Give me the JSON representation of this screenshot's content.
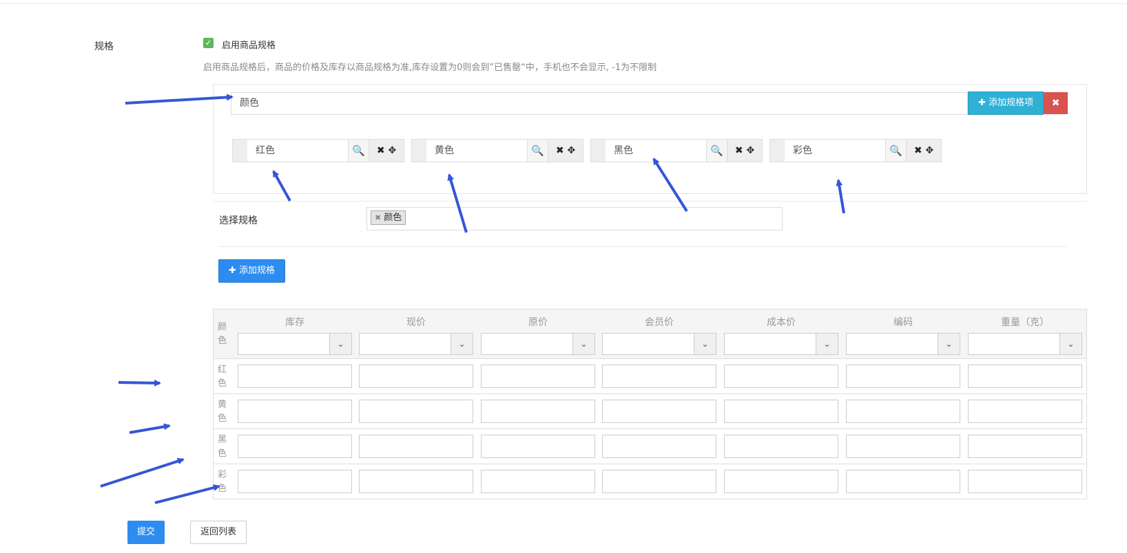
{
  "spec": {
    "label": "规格",
    "enable_checkbox_label": "启用商品规格",
    "enable_checked": true,
    "hint": "启用商品规格后，商品的价格及库存以商品规格为准,库存设置为0则会到”已售罄“中，手机也不会显示, -1为不限制"
  },
  "spec_group": {
    "name_value": "颜色",
    "add_item_label": "✚ 添加规格项",
    "remove_icon": "close-icon",
    "items": [
      {
        "value": "红色"
      },
      {
        "value": "黄色"
      },
      {
        "value": "黑色"
      },
      {
        "value": "彩色"
      }
    ]
  },
  "select_spec": {
    "label": "选择规格",
    "selected_tags": [
      "颜色"
    ]
  },
  "add_spec_label": "✚ 添加规格",
  "table": {
    "first_col_header": "颜色",
    "columns": [
      "库存",
      "现价",
      "原价",
      "会员价",
      "成本价",
      "编码",
      "重量（克）"
    ],
    "rows": [
      "红色",
      "黄色",
      "黑色",
      "彩色"
    ]
  },
  "buttons": {
    "submit": "提交",
    "back": "返回列表"
  },
  "colors": {
    "primary": "#2d8cf0",
    "info": "#31b0d5",
    "danger": "#d9534f",
    "success": "#5cb85c",
    "annotation_arrow": "#3456d6"
  }
}
